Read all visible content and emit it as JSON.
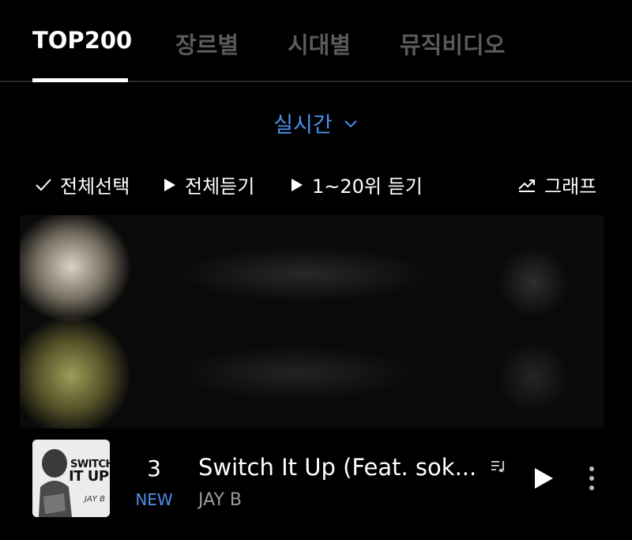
{
  "tabs": [
    {
      "label": "TOP200",
      "active": true
    },
    {
      "label": "장르별",
      "active": false
    },
    {
      "label": "시대별",
      "active": false
    },
    {
      "label": "뮤직비디오",
      "active": false
    }
  ],
  "period": {
    "label": "실시간",
    "icon": "chevron-down-icon"
  },
  "toolbar": {
    "select_all": "전체선택",
    "play_all": "전체듣기",
    "play_top20": "1~20위 듣기",
    "graph": "그래프"
  },
  "chart_row": {
    "rank": "3",
    "rank_status": "NEW",
    "title": "Switch It Up (Feat. sok...",
    "artist": "JAY B",
    "cover_text_line1": "SWITCH",
    "cover_text_line2": "IT UP",
    "cover_signature": "JAY B"
  },
  "colors": {
    "accent": "#4b8fe8",
    "background": "#000000",
    "inactive_tab": "#5a5a5a",
    "secondary_text": "#9a9a9a"
  }
}
